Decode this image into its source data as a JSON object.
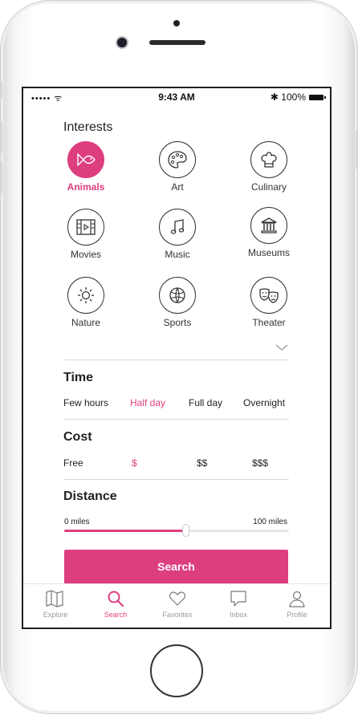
{
  "status_bar": {
    "signal": "••••• ᯤ",
    "time": "9:43 AM",
    "battery": "✱ 100%"
  },
  "interests": {
    "title": "Interests",
    "items": [
      {
        "label": "Animals",
        "icon": "fish-icon",
        "active": true
      },
      {
        "label": "Art",
        "icon": "palette-icon",
        "active": false
      },
      {
        "label": "Culinary",
        "icon": "chef-hat-icon",
        "active": false
      },
      {
        "label": "Movies",
        "icon": "film-icon",
        "active": false
      },
      {
        "label": "Music",
        "icon": "music-note-icon",
        "active": false
      },
      {
        "label": "Museums",
        "icon": "museum-icon",
        "active": false
      },
      {
        "label": "Nature",
        "icon": "sun-icon",
        "active": false
      },
      {
        "label": "Sports",
        "icon": "ball-icon",
        "active": false
      },
      {
        "label": "Theater",
        "icon": "theater-masks-icon",
        "active": false
      }
    ]
  },
  "time": {
    "title": "Time",
    "options": [
      "Few hours",
      "Half day",
      "Full day",
      "Overnight"
    ],
    "selected": "Half day"
  },
  "cost": {
    "title": "Cost",
    "options": [
      "Free",
      "$",
      "$$",
      "$$$"
    ],
    "selected": "$"
  },
  "distance": {
    "title": "Distance",
    "min_label": "0 miles",
    "max_label": "100 miles",
    "value_fraction": 0.54
  },
  "search_button": "Search",
  "tabs": [
    {
      "label": "Explore",
      "icon": "map-icon",
      "active": false
    },
    {
      "label": "Search",
      "icon": "search-icon",
      "active": true
    },
    {
      "label": "Favorites",
      "icon": "heart-icon",
      "active": false
    },
    {
      "label": "Inbox",
      "icon": "chat-bubble-icon",
      "active": false
    },
    {
      "label": "Profile",
      "icon": "user-icon",
      "active": false
    }
  ],
  "colors": {
    "accent": "#dd3e7e",
    "text": "#222222",
    "muted": "#9a9a9a"
  }
}
